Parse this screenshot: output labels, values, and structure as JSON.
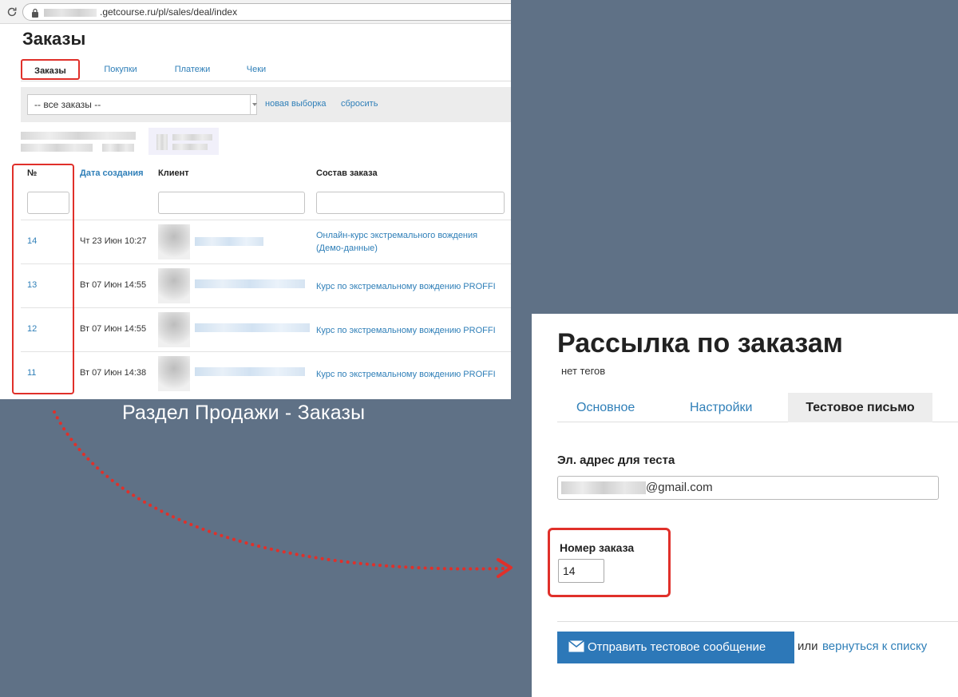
{
  "browser": {
    "url_text": ".getcourse.ru/pl/sales/deal/index"
  },
  "orders_page": {
    "title": "Заказы",
    "tabs": [
      {
        "label": "Заказы",
        "active": true
      },
      {
        "label": "Покупки",
        "active": false
      },
      {
        "label": "Платежи",
        "active": false
      },
      {
        "label": "Чеки",
        "active": false
      }
    ],
    "filter": {
      "select_value": "-- все заказы --",
      "new_selection_link": "новая выборка",
      "reset_link": "сбросить"
    },
    "table": {
      "columns": [
        "№",
        "Дата создания",
        "Клиент",
        "Состав заказа"
      ],
      "rows": [
        {
          "number": "14",
          "date": "Чт 23 Июн 10:27",
          "product": "Онлайн-курс экстремального вождения (Демо-данные)"
        },
        {
          "number": "13",
          "date": "Вт 07 Июн 14:55",
          "product": "Курс по экстремальному вождению PROFFI"
        },
        {
          "number": "12",
          "date": "Вт 07 Июн 14:55",
          "product": "Курс по экстремальному вождению PROFFI"
        },
        {
          "number": "11",
          "date": "Вт 07 Июн 14:38",
          "product": "Курс по экстремальному вождению PROFFI"
        }
      ]
    }
  },
  "caption": "Раздел Продажи - Заказы",
  "mailing_page": {
    "title": "Рассылка по заказам",
    "tags_note": "нет тегов",
    "tabs": [
      {
        "label": "Основное",
        "active": false
      },
      {
        "label": "Настройки",
        "active": false
      },
      {
        "label": "Тестовое письмо",
        "active": true
      }
    ],
    "email_label": "Эл. адрес для теста",
    "email_value": "@gmail.com",
    "order_number_label": "Номер заказа",
    "order_number_value": "14",
    "send_button_label": "Отправить тестовое сообщение",
    "or_text": "или",
    "back_link": "вернуться к списку"
  },
  "colors": {
    "background": "#5f7186",
    "highlight_red": "#e0302a",
    "link_blue": "#2f7fb8",
    "button_blue": "#2d78b8"
  }
}
